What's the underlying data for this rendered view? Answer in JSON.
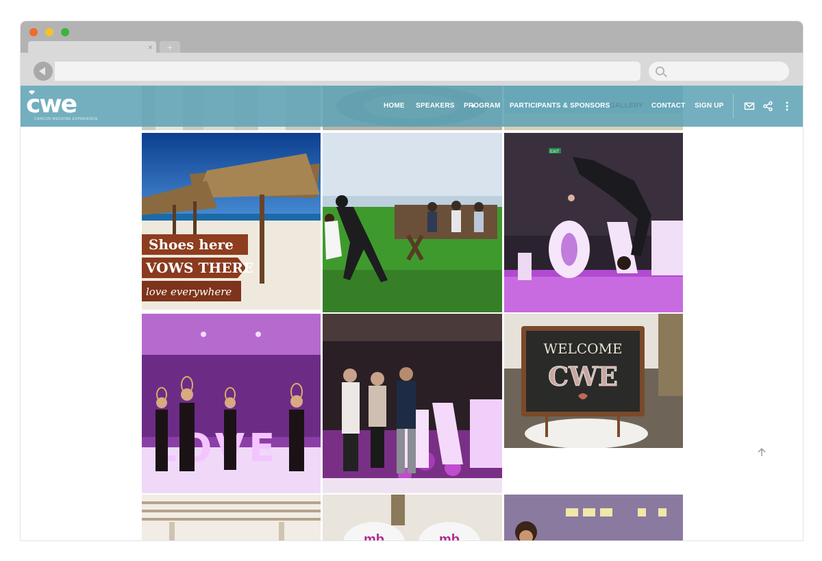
{
  "browser": {
    "tab_close": "×",
    "new_tab": "+",
    "icons": [
      "back-icon",
      "search-icon"
    ]
  },
  "site": {
    "logo_text": "cwe",
    "logo_tagline": "CANCUN WEDDING EXPERIENCE",
    "nav": [
      {
        "label": "HOME",
        "active": false
      },
      {
        "label": "SPEAKERS",
        "active": false,
        "has_dropdown": true
      },
      {
        "label": "PROGRAM",
        "active": false
      },
      {
        "label": "PARTICIPANTS & SPONSORS",
        "active": false
      },
      {
        "label": "GALLERY",
        "active": true
      },
      {
        "label": "CONTACT",
        "active": false
      },
      {
        "label": "SIGN UP",
        "active": false
      }
    ],
    "header_icons": [
      "mail-icon",
      "share-icon",
      "more-vertical-icon"
    ],
    "colors": {
      "header": "#60a4b6",
      "active_nav": "#5d8f9c"
    }
  },
  "gallery": {
    "photo_text": {
      "sign_line1": "Shoes here",
      "sign_line2": "VOWS THERE",
      "sign_line3": "love everywhere",
      "love_word": "LOVE",
      "chalk_line1": "WELCOME",
      "chalk_line2": "CWE",
      "exit_sign": "EXIT",
      "mb_logo": "mb"
    }
  }
}
